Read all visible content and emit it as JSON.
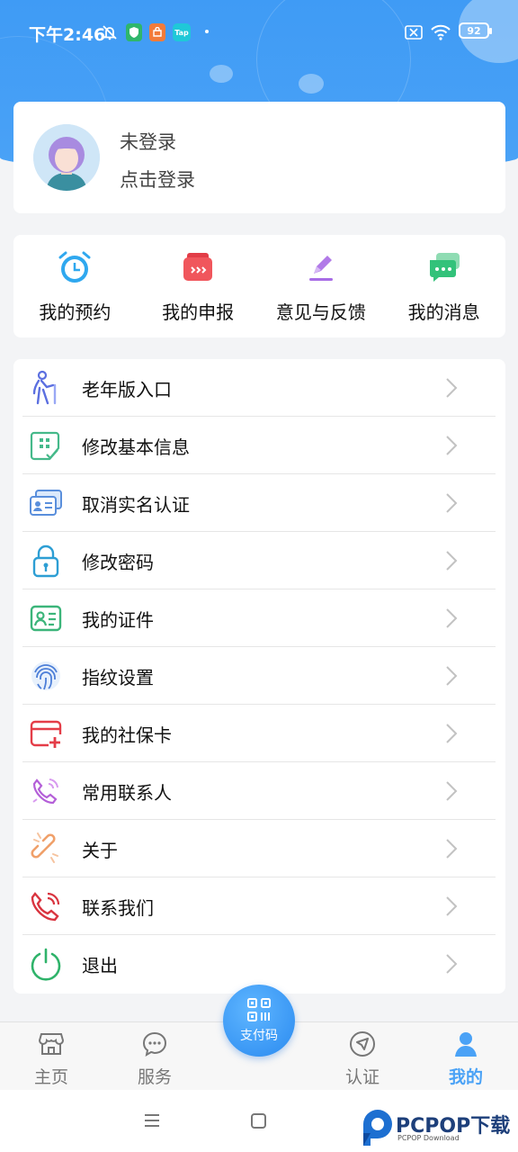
{
  "status_bar": {
    "time": "下午2:46",
    "battery": "92",
    "icons": [
      "mute-bell-icon",
      "shield-app-icon",
      "taobao-app-icon",
      "taptap-app-icon",
      "sim-icon",
      "wifi-icon",
      "battery-icon"
    ],
    "taptap_label": "Tap"
  },
  "login": {
    "title": "未登录",
    "subtitle": "点击登录"
  },
  "quick_actions": [
    {
      "label": "我的预约",
      "icon": "alarm-clock-icon",
      "color": "#2fa8ef"
    },
    {
      "label": "我的申报",
      "icon": "report-box-icon",
      "color": "#f0565c"
    },
    {
      "label": "意见与反馈",
      "icon": "pen-edit-icon",
      "color": "#a86ce6"
    },
    {
      "label": "我的消息",
      "icon": "chat-bubbles-icon",
      "color": "#33c27a"
    }
  ],
  "menu": [
    {
      "label": "老年版入口",
      "icon": "elderly-icon"
    },
    {
      "label": "修改基本信息",
      "icon": "edit-info-icon"
    },
    {
      "label": "取消实名认证",
      "icon": "id-cards-icon"
    },
    {
      "label": "修改密码",
      "icon": "lock-icon"
    },
    {
      "label": "我的证件",
      "icon": "certificate-icon"
    },
    {
      "label": "指纹设置",
      "icon": "fingerprint-icon"
    },
    {
      "label": "我的社保卡",
      "icon": "social-card-icon"
    },
    {
      "label": "常用联系人",
      "icon": "contact-phone-icon"
    },
    {
      "label": "关于",
      "icon": "link-icon"
    },
    {
      "label": "联系我们",
      "icon": "phone-call-icon"
    },
    {
      "label": "退出",
      "icon": "power-icon"
    }
  ],
  "tabbar": {
    "tabs": [
      {
        "label": "主页",
        "icon": "store-icon"
      },
      {
        "label": "服务",
        "icon": "chat-dots-icon"
      },
      {
        "label": "认证",
        "icon": "navigation-icon"
      },
      {
        "label": "我的",
        "icon": "person-icon",
        "active": true
      }
    ],
    "center_button": {
      "label": "支付码",
      "icon": "qr-code-icon"
    }
  },
  "watermark": {
    "main": "PCPOP下载",
    "sub": "PCPOP Download"
  },
  "colors": {
    "brand": "#4aa2f6",
    "background": "#f3f4f6"
  }
}
